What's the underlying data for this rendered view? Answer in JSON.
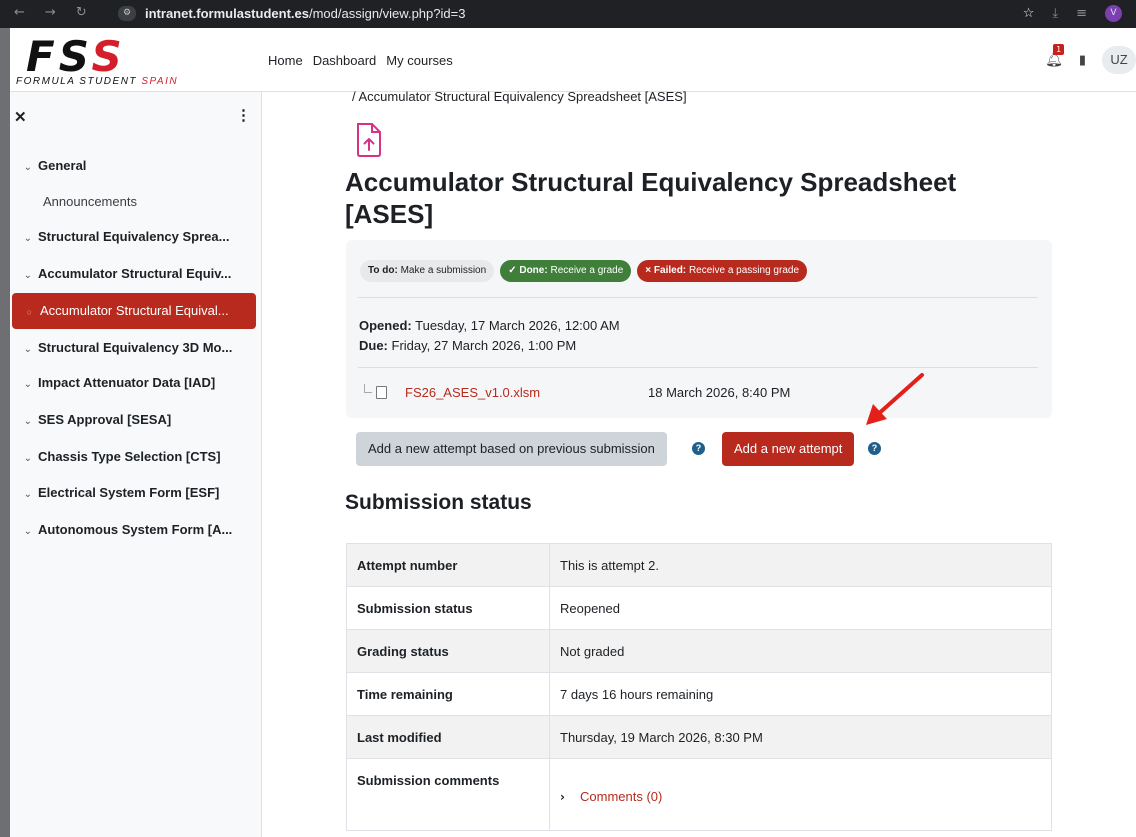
{
  "browser": {
    "url_host": "intranet.formulastudent.es",
    "url_path": "/mod/assign/view.php?id=3",
    "profile_initial": "V"
  },
  "navbar": {
    "logo_mark_a": "F",
    "logo_mark_b": "S",
    "logo_mark_c": "S",
    "logo_sub": "FORMULA STUDENT",
    "logo_sub_red": "SPAIN",
    "links": [
      "Home",
      "Dashboard",
      "My courses"
    ],
    "notification_count": "1",
    "user_initials": "UZ"
  },
  "sidebar": {
    "items": [
      {
        "label": "General",
        "type": "section"
      },
      {
        "label": "Announcements",
        "type": "sub"
      },
      {
        "label": "Structural Equivalency Sprea...",
        "type": "section"
      },
      {
        "label": "Accumulator Structural Equiv...",
        "type": "section"
      },
      {
        "label": "Accumulator Structural Equival...",
        "type": "active"
      },
      {
        "label": "Structural Equivalency 3D Mo...",
        "type": "section"
      },
      {
        "label": "Impact Attenuator Data [IAD]",
        "type": "section"
      },
      {
        "label": "SES Approval [SESA]",
        "type": "section"
      },
      {
        "label": "Chassis Type Selection [CTS]",
        "type": "section"
      },
      {
        "label": "Electrical System Form [ESF]",
        "type": "section"
      },
      {
        "label": "Autonomous System Form [A...",
        "type": "section"
      }
    ]
  },
  "main": {
    "breadcrumb": "/ Accumulator Structural Equivalency Spreadsheet [ASES]",
    "title": "Accumulator Structural Equivalency Spreadsheet [ASES]",
    "badges": {
      "todo_label": "To do:",
      "todo_text": "Make a submission",
      "done_label": "✓ Done:",
      "done_text": "Receive a grade",
      "failed_label": "× Failed:",
      "failed_text": "Receive a passing grade"
    },
    "dates": {
      "opened_label": "Opened:",
      "opened_value": "Tuesday, 17 March 2026, 12:00 AM",
      "due_label": "Due:",
      "due_value": "Friday, 27 March 2026, 1:00 PM"
    },
    "file": {
      "name": "FS26_ASES_v1.0.xlsm",
      "date": "18 March 2026, 8:40 PM"
    },
    "buttons": {
      "prev_attempt": "Add a new attempt based on previous submission",
      "new_attempt": "Add a new attempt",
      "help": "?"
    },
    "section_title": "Submission status",
    "status_rows": [
      {
        "key": "Attempt number",
        "value": "This is attempt 2."
      },
      {
        "key": "Submission status",
        "value": "Reopened"
      },
      {
        "key": "Grading status",
        "value": "Not graded"
      },
      {
        "key": "Time remaining",
        "value": "7 days 16 hours remaining"
      },
      {
        "key": "Last modified",
        "value": "Thursday, 19 March 2026, 8:30 PM"
      },
      {
        "key": "Submission comments",
        "value": "Comments (0)"
      }
    ]
  },
  "colors": {
    "accent": "#b82a1e",
    "success": "#3f7f3a",
    "help": "#1f5f8b"
  }
}
